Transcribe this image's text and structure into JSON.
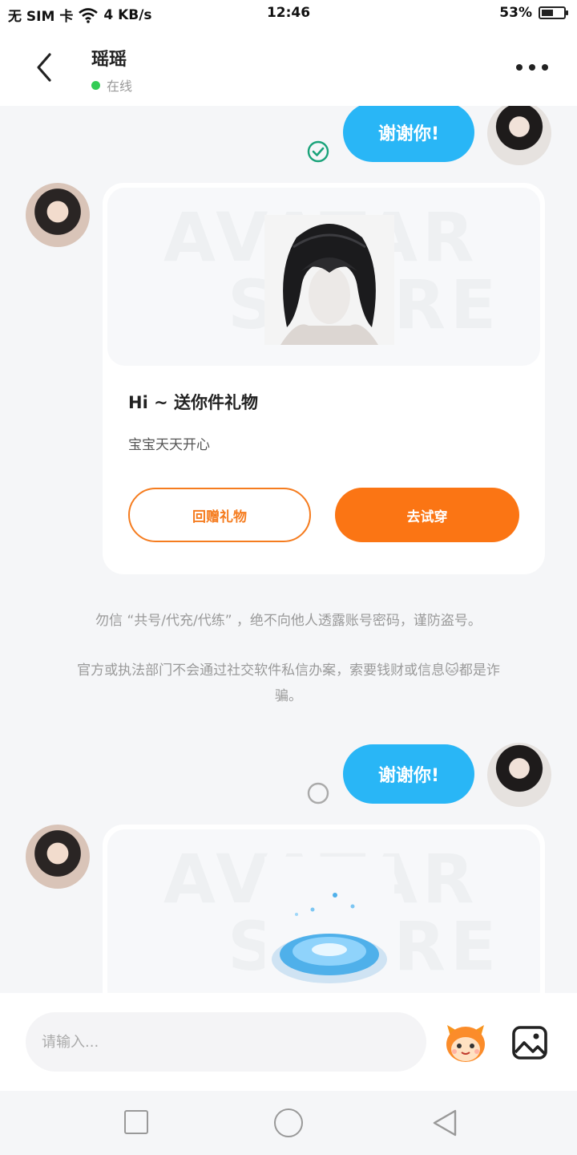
{
  "status_bar": {
    "carrier": "无 SIM 卡",
    "speed": "4 KB/s",
    "time": "12:46",
    "battery": "53%",
    "battery_level": 0.53
  },
  "header": {
    "contact_name": "瑶瑶",
    "status": "在线"
  },
  "messages": {
    "sent_1": {
      "text": "谢谢你!",
      "status_icon": "check-circle-icon"
    },
    "gift_card": {
      "watermark_line1": "AVATAR",
      "watermark_line2": "STORE",
      "title": "Hi ~ 送你件礼物",
      "subtitle": "宝宝天天开心",
      "return_gift_label": "回赠礼物",
      "try_on_label": "去试穿"
    },
    "notice_1": "勿信 “共号/代充/代练” ，绝不向他人透露账号密码，谨防盗号。",
    "notice_2": "官方或执法部门不会通过社交软件私信办案，索要钱财或信息🐱都是诈骗。",
    "sent_2": {
      "text": "谢谢你!",
      "status_icon": "pending-circle-icon"
    },
    "gift_card_2": {
      "watermark_line1": "AVATAR",
      "watermark_line2": "STORE"
    }
  },
  "input_bar": {
    "placeholder": "请输入..."
  },
  "colors": {
    "bubble": "#29b6f6",
    "accent": "#fb7514",
    "online": "#33cc55",
    "check": "#1aa37a"
  }
}
